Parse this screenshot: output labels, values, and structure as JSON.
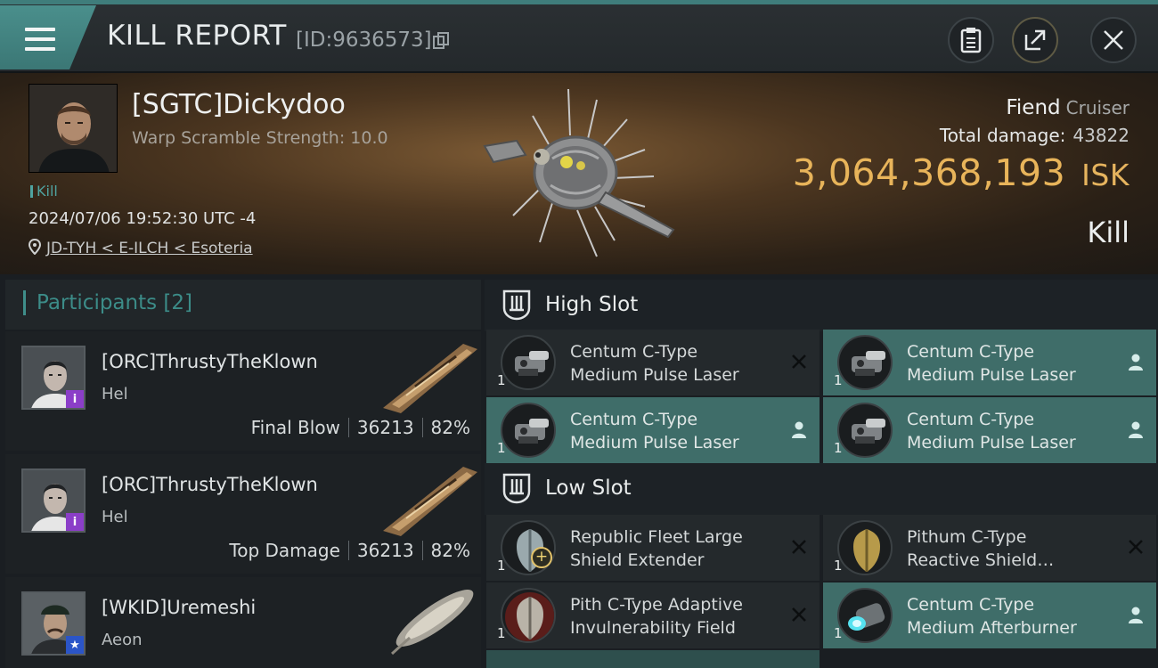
{
  "header": {
    "title": "KILL REPORT",
    "report_id": "[ID:9636573]",
    "icons": [
      "menu-icon",
      "copy-icon",
      "clipboard-icon",
      "share-icon",
      "close-icon"
    ]
  },
  "victim": {
    "name": "[SGTC]Dickydoo",
    "warp_scramble": "Warp Scramble Strength: 10.0",
    "kill_tag": "Kill",
    "datetime": "2024/07/06 19:52:30 UTC -4",
    "location": "JD-TYH < E-ILCH < Esoteria"
  },
  "summary": {
    "ship": "Fiend",
    "ship_class": "Cruiser",
    "total_damage_label": "Total damage:",
    "total_damage": "43822",
    "isk_value": "3,064,368,193",
    "isk_unit": "ISK",
    "result": "Kill"
  },
  "participants": {
    "header": "Participants [2]",
    "items": [
      {
        "name": "[ORC]ThrustyTheKlown",
        "ship": "Hel",
        "role": "Final Blow",
        "damage": "36213",
        "percent": "82%"
      },
      {
        "name": "[ORC]ThrustyTheKlown",
        "ship": "Hel",
        "role": "Top Damage",
        "damage": "36213",
        "percent": "82%"
      },
      {
        "name": "[WKID]Uremeshi",
        "ship": "Aeon"
      }
    ]
  },
  "fitting": {
    "high_slot": {
      "title": "High Slot",
      "modules": [
        {
          "line1": "Centum C-Type",
          "line2": "Medium Pulse Laser",
          "qty": "1",
          "status": "destroyed"
        },
        {
          "line1": "Centum C-Type",
          "line2": "Medium Pulse Laser",
          "qty": "1",
          "status": "dropped"
        },
        {
          "line1": "Centum C-Type",
          "line2": "Medium Pulse Laser",
          "qty": "1",
          "status": "dropped"
        },
        {
          "line1": "Centum C-Type",
          "line2": "Medium Pulse Laser",
          "qty": "1",
          "status": "dropped"
        }
      ]
    },
    "low_slot": {
      "title": "Low Slot",
      "modules": [
        {
          "line1": "Republic Fleet Large",
          "line2": "Shield Extender",
          "qty": "1",
          "status": "destroyed"
        },
        {
          "line1": "Pithum C-Type",
          "line2": "Reactive Shield…",
          "qty": "1",
          "status": "destroyed"
        },
        {
          "line1": "Pith C-Type Adaptive",
          "line2": "Invulnerability Field",
          "qty": "1",
          "status": "destroyed"
        },
        {
          "line1": "Centum C-Type",
          "line2": "Medium Afterburner",
          "qty": "1",
          "status": "dropped"
        }
      ]
    }
  },
  "colors": {
    "accent": "#3f7d7b",
    "isk": "#e8b45a",
    "module_active": "#3f6d69",
    "participants_header": "#3c8c88"
  }
}
